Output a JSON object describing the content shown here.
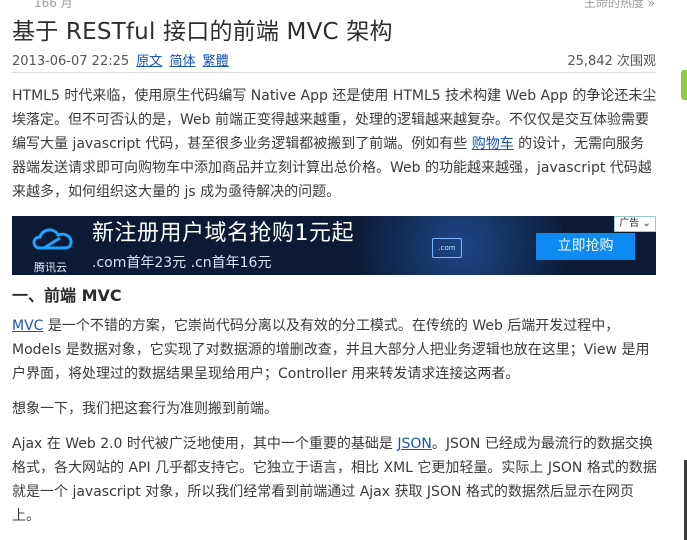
{
  "breadcrumb": {
    "left": "166 月",
    "right": "王命的热度 »"
  },
  "article": {
    "title": "基于 RESTful 接口的前端 MVC 架构",
    "date": "2013-06-07 22:25",
    "links": [
      "原文",
      "简体",
      "繁體"
    ],
    "views": "25,842 次围观",
    "intro_a": "HTML5 时代来临，使用原生代码编写 Native App 还是使用 HTML5 技术构建 Web App 的争论还未尘埃落定。但不可否认的是，Web 前端正变得越来越重，处理的逻辑越来越复杂。不仅仅是交互体验需要编写大量 javascript 代码，甚至很多业务逻辑都被搬到了前端。例如有些 ",
    "intro_link": "购物车",
    "intro_b": " 的设计，无需向服务器端发送请求即可向购物车中添加商品并立刻计算出总价格。Web 的功能越来越强，javascript 代码越来越多，如何组织这大量的 js 成为亟待解决的问题。",
    "section1_title": "一、前端 MVC",
    "p2_link": "MVC",
    "p2_text": " 是一个不错的方案，它崇尚代码分离以及有效的分工模式。在传统的 Web 后端开发过程中，Models 是数据对象，它实现了对数据源的增删改查，并且大部分人把业务逻辑也放在这里；View 是用户界面，将处理过的数据结果呈现给用户；Controller 用来转发请求连接这两者。",
    "p3_text": "想象一下，我们把这套行为准则搬到前端。",
    "p4_a": "Ajax 在 Web 2.0 时代被广泛地使用，其中一个重要的基础是 ",
    "p4_link": "JSON",
    "p4_b": "。JSON 已经成为最流行的数据交换格式，各大网站的 API 几乎都支持它。它独立于语言，相比 XML 它更加轻量。实际上 JSON 格式的数据就是一个 javascript 对象，所以我们经常看到前端通过 Ajax 获取 JSON 格式的数据然后显示在网页上。"
  },
  "ad": {
    "brand": "腾讯云",
    "headline": "新注册用户域名抢购1元起",
    "sub": ".com首年23元 .cn首年16元",
    "card": ".com",
    "cta": "立即抢购",
    "tag": "广告"
  }
}
